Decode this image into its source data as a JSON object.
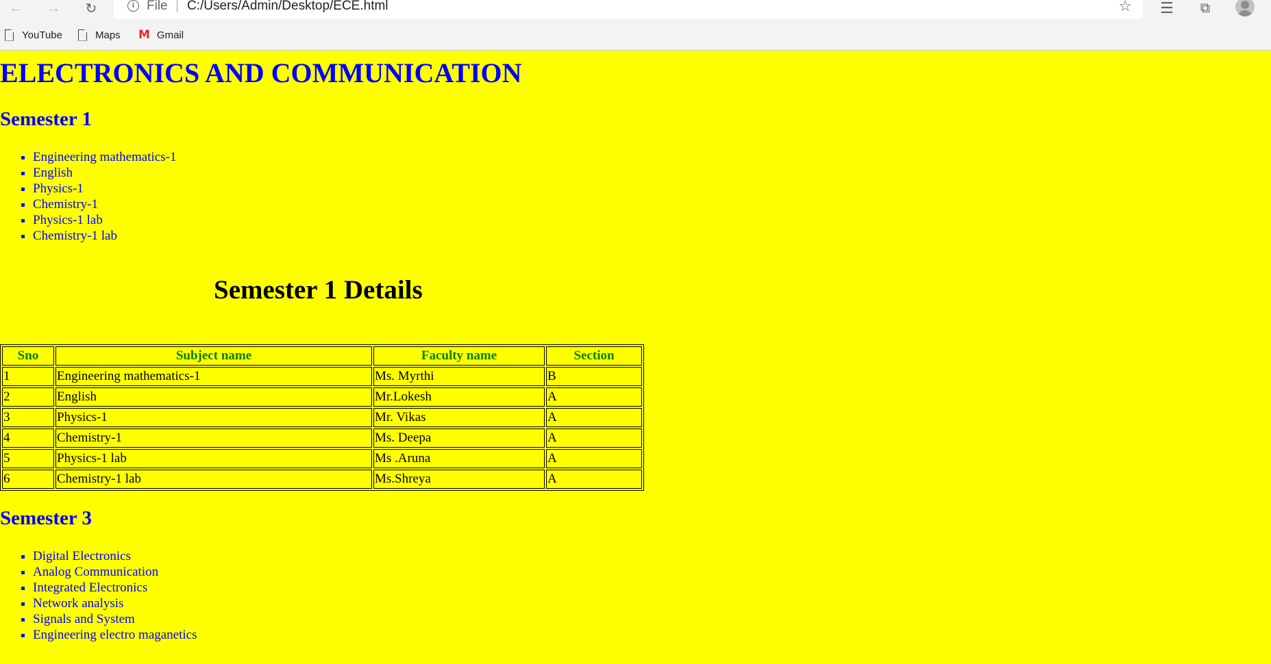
{
  "browser": {
    "address": {
      "scheme_label": "File",
      "url": "C:/Users/Admin/Desktop/ECE.html"
    },
    "bookmarks": [
      {
        "label": "YouTube",
        "icon": "page-icon"
      },
      {
        "label": "Maps",
        "icon": "page-icon"
      },
      {
        "label": "Gmail",
        "icon": "gmail-icon"
      }
    ]
  },
  "page": {
    "title": "ELECTRONICS AND COMMUNICATION",
    "semester1": {
      "heading": "Semester 1",
      "subjects": [
        "Engineering mathematics-1",
        "English",
        "Physics-1",
        "Chemistry-1",
        "Physics-1 lab",
        "Chemistry-1 lab"
      ]
    },
    "details": {
      "heading": "Semester 1 Details",
      "columns": [
        "Sno",
        "Subject name",
        "Faculty name",
        "Section"
      ],
      "rows": [
        [
          "1",
          "Engineering mathematics-1",
          "Ms. Myrthi",
          "B"
        ],
        [
          "2",
          "English",
          "Mr.Lokesh",
          "A"
        ],
        [
          "3",
          "Physics-1",
          "Mr. Vikas",
          "A"
        ],
        [
          "4",
          "Chemistry-1",
          "Ms. Deepa",
          "A"
        ],
        [
          "5",
          "Physics-1 lab",
          "Ms .Aruna",
          "A"
        ],
        [
          "6",
          "Chemistry-1 lab",
          "Ms.Shreya",
          "A"
        ]
      ]
    },
    "semester3": {
      "heading": "Semester 3",
      "subjects": [
        "Digital Electronics",
        "Analog Communication",
        "Integrated Electronics",
        "Network analysis",
        "Signals and System",
        "Engineering electro maganetics"
      ]
    }
  },
  "colors": {
    "background": "#ffff00",
    "heading": "#0000ff",
    "table_header": "#008000"
  }
}
